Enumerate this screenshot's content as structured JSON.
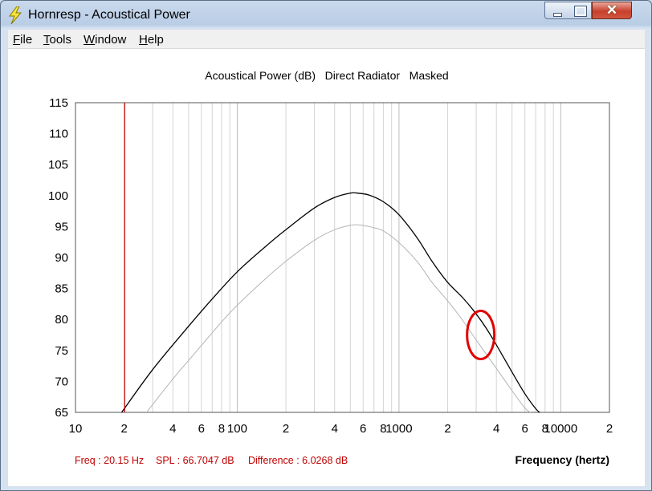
{
  "window": {
    "title": "Hornresp - Acoustical Power"
  },
  "menu": [
    {
      "label": "File",
      "key": "F",
      "rest": "ile"
    },
    {
      "label": "Tools",
      "key": "T",
      "rest": "ools"
    },
    {
      "label": "Window",
      "key": "W",
      "rest": "indow"
    },
    {
      "label": "Help",
      "key": "H",
      "rest": "elp"
    }
  ],
  "status": {
    "freq": "Freq : 20.15 Hz",
    "spl": "SPL : 66.7047 dB",
    "difference": "Difference : 6.0268 dB"
  },
  "colors": {
    "cursor": "#cc0000",
    "primary_curve": "#000000",
    "secondary_curve": "#b4b4b4",
    "highlight": "#e00000",
    "grid": "#d4d4d4"
  },
  "chart_data": {
    "type": "line",
    "title": "Acoustical Power (dB)   Direct Radiator   Masked",
    "xlabel": "Frequency (hertz)",
    "ylabel": "",
    "x_scale": "log",
    "xlim": [
      10,
      20000
    ],
    "ylim": [
      65,
      115
    ],
    "y_ticks": [
      65,
      70,
      75,
      80,
      85,
      90,
      95,
      100,
      105,
      110,
      115
    ],
    "x_ticks": [
      {
        "value": 10,
        "label": "10"
      },
      {
        "value": 20,
        "label": "2"
      },
      {
        "value": 40,
        "label": "4"
      },
      {
        "value": 60,
        "label": "6"
      },
      {
        "value": 80,
        "label": "8"
      },
      {
        "value": 100,
        "label": "100"
      },
      {
        "value": 200,
        "label": "2"
      },
      {
        "value": 400,
        "label": "4"
      },
      {
        "value": 600,
        "label": "6"
      },
      {
        "value": 800,
        "label": "8"
      },
      {
        "value": 1000,
        "label": "1000"
      },
      {
        "value": 2000,
        "label": "2"
      },
      {
        "value": 4000,
        "label": "4"
      },
      {
        "value": 6000,
        "label": "6"
      },
      {
        "value": 8000,
        "label": "8"
      },
      {
        "value": 10000,
        "label": "10000"
      },
      {
        "value": 20000,
        "label": "2"
      }
    ],
    "cursor_frequency": 20.15,
    "highlight_frequency": 3200,
    "highlight_level": 77.5,
    "series": [
      {
        "x": [
          19.3,
          30,
          50,
          70,
          100,
          150,
          200,
          300,
          400,
          500,
          550,
          650,
          800,
          1000,
          1300,
          1600,
          2000,
          2500,
          3000,
          3500,
          4000,
          5000,
          6000,
          7000,
          7400
        ],
        "values": [
          65,
          71.9,
          78.9,
          83.3,
          87.7,
          91.8,
          94.5,
          98.0,
          99.7,
          100.4,
          100.4,
          100.1,
          99.0,
          96.9,
          93.1,
          89.4,
          86.0,
          83.4,
          80.9,
          78.4,
          75.9,
          71.5,
          68.0,
          65.6,
          65
        ]
      },
      {
        "x": [
          27.5,
          40,
          60,
          80,
          100,
          150,
          200,
          300,
          400,
          500,
          550,
          600,
          700,
          800,
          1000,
          1300,
          1600,
          2000,
          2500,
          3000,
          4000,
          5000,
          6000,
          6500
        ],
        "values": [
          65,
          70.4,
          75.8,
          79.6,
          82.3,
          86.6,
          89.4,
          92.8,
          94.5,
          95.2,
          95.3,
          95.2,
          94.8,
          94.3,
          92.4,
          89.3,
          86.0,
          83.0,
          79.7,
          76.7,
          72.1,
          68.5,
          65.7,
          65
        ]
      }
    ]
  }
}
